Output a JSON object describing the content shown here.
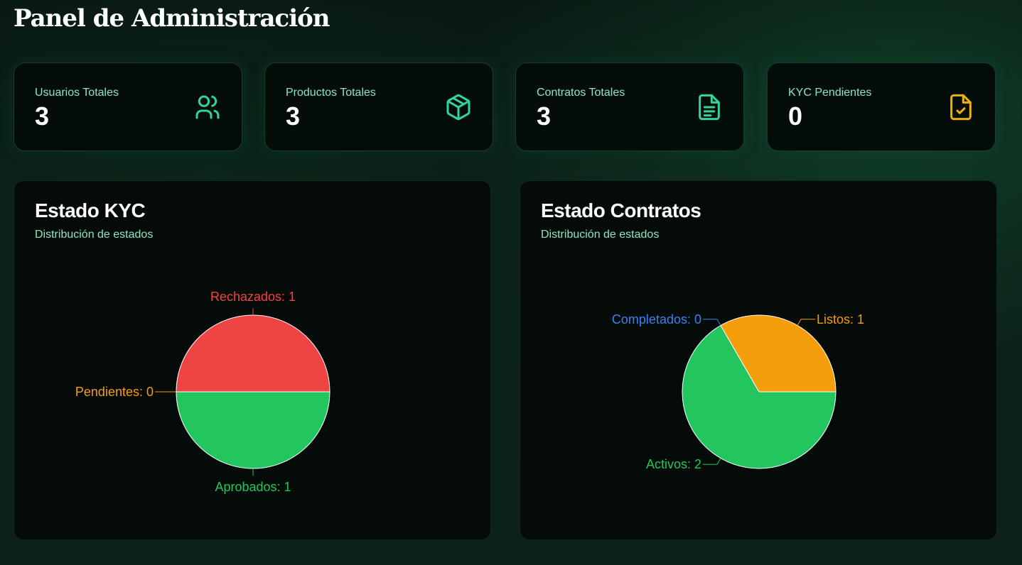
{
  "page": {
    "title": "Panel de Administración"
  },
  "stats": [
    {
      "label": "Usuarios Totales",
      "value": "3",
      "icon": "users-icon",
      "color": "#34d399"
    },
    {
      "label": "Productos Totales",
      "value": "3",
      "icon": "package-icon",
      "color": "#34d399"
    },
    {
      "label": "Contratos Totales",
      "value": "3",
      "icon": "document-icon",
      "color": "#34d399"
    },
    {
      "label": "KYC Pendientes",
      "value": "0",
      "icon": "file-check-icon",
      "color": "#eab308"
    }
  ],
  "charts": {
    "kyc": {
      "title": "Estado KYC",
      "subtitle": "Distribución de estados"
    },
    "contracts": {
      "title": "Estado Contratos",
      "subtitle": "Distribución de estados"
    }
  },
  "chart_data": [
    {
      "type": "pie",
      "title": "Estado KYC",
      "slices": [
        {
          "name": "Aprobados",
          "value": 1,
          "label": "Aprobados: 1",
          "color": "#22c55e"
        },
        {
          "name": "Pendientes",
          "value": 0,
          "label": "Pendientes: 0",
          "color": "#f59e0b"
        },
        {
          "name": "Rechazados",
          "value": 1,
          "label": "Rechazados: 1",
          "color": "#ef4444"
        }
      ]
    },
    {
      "type": "pie",
      "title": "Estado Contratos",
      "slices": [
        {
          "name": "Activos",
          "value": 2,
          "label": "Activos: 2",
          "color": "#22c55e"
        },
        {
          "name": "Completados",
          "value": 0,
          "label": "Completados: 0",
          "color": "#3b82f6"
        },
        {
          "name": "Listos",
          "value": 1,
          "label": "Listos: 1",
          "color": "#f59e0b"
        }
      ]
    }
  ]
}
